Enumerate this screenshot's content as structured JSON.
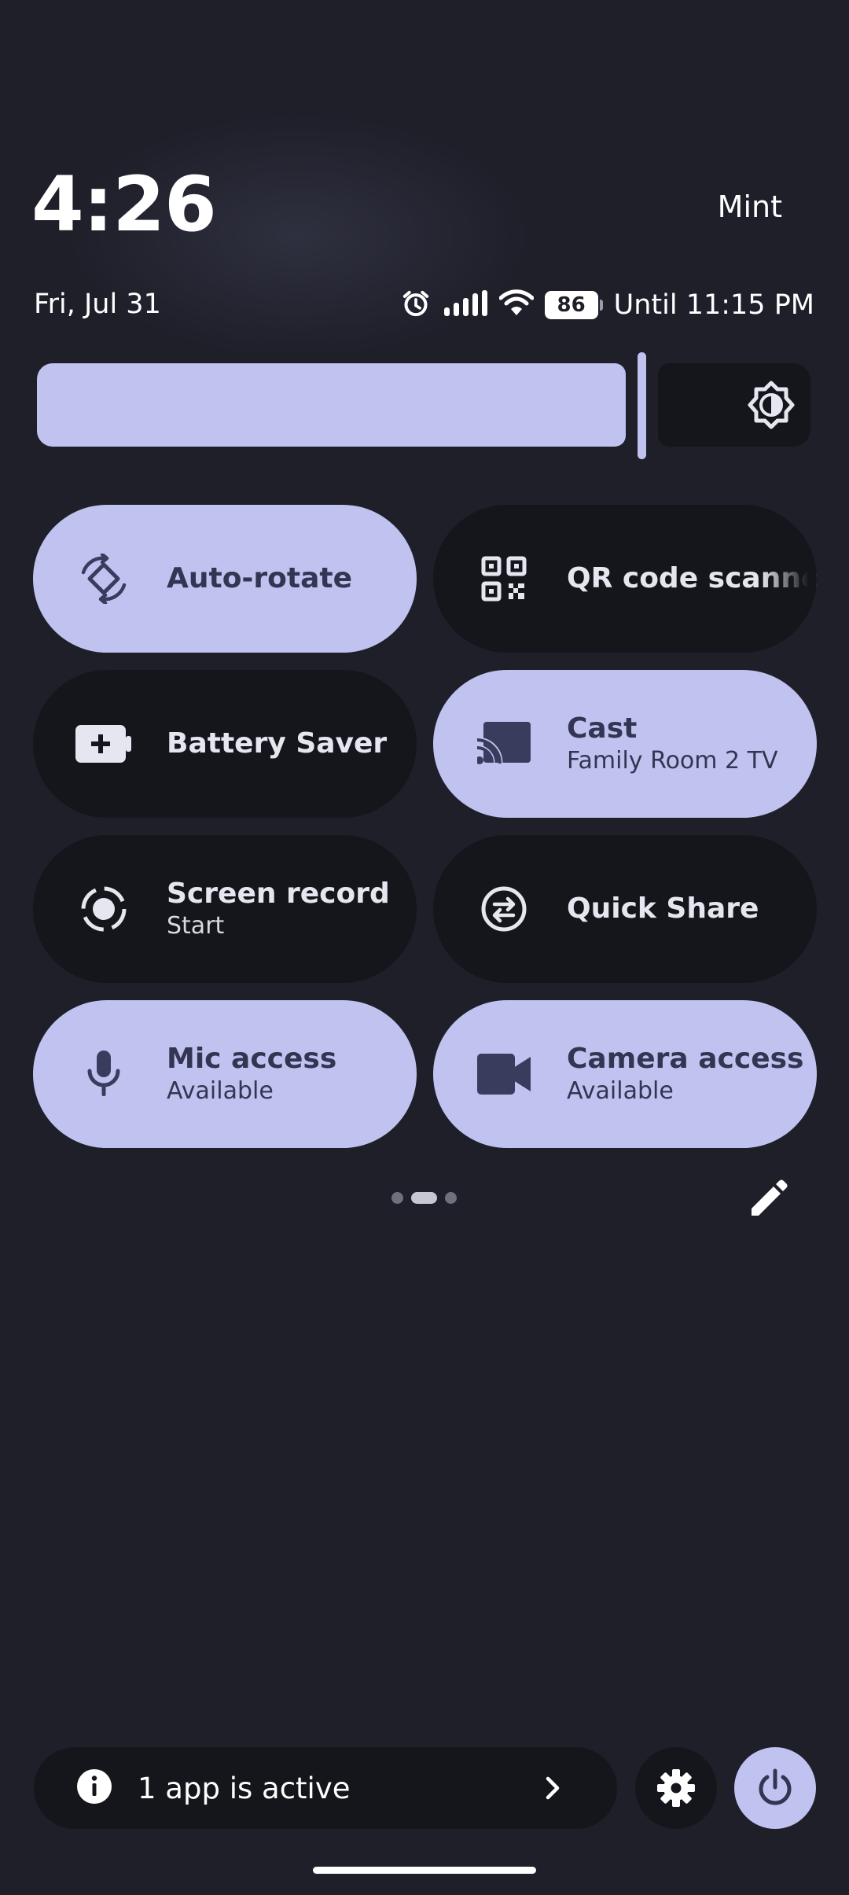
{
  "header": {
    "time": "4:26",
    "carrier": "Mint",
    "date": "Fri, Jul 31",
    "battery_level": "86",
    "battery_until": "Until 11:15 PM"
  },
  "brightness": {
    "level_fraction": 0.76
  },
  "tiles": [
    {
      "label": "Auto-rotate",
      "sublabel": "",
      "state": "on",
      "icon": "auto-rotate-icon"
    },
    {
      "label": "QR code scanner",
      "sublabel": "",
      "state": "off",
      "icon": "qr-code-icon"
    },
    {
      "label": "Battery Saver",
      "sublabel": "",
      "state": "off",
      "icon": "battery-saver-icon"
    },
    {
      "label": "Cast",
      "sublabel": "Family Room 2 TV",
      "state": "on",
      "icon": "cast-icon"
    },
    {
      "label": "Screen record",
      "sublabel": "Start",
      "state": "off",
      "icon": "screen-record-icon"
    },
    {
      "label": "Quick Share",
      "sublabel": "",
      "state": "off",
      "icon": "quick-share-icon"
    },
    {
      "label": "Mic access",
      "sublabel": "Available",
      "state": "on",
      "icon": "mic-icon"
    },
    {
      "label": "Camera access",
      "sublabel": "Available",
      "state": "on",
      "icon": "camera-icon"
    }
  ],
  "pager": {
    "pages": 3,
    "current": 2
  },
  "bottom": {
    "active_apps_label": "1 app is active"
  },
  "colors": {
    "background": "#1f1f2a",
    "tile_on": "#c0c3ef",
    "tile_off": "#15151c",
    "tile_on_text": "#333553"
  }
}
